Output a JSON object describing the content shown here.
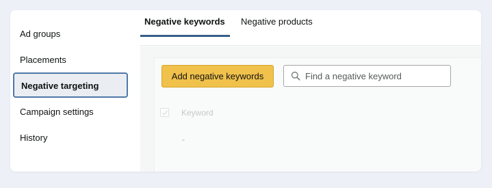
{
  "sidebar": {
    "items": [
      {
        "label": "Ad groups",
        "active": false
      },
      {
        "label": "Placements",
        "active": false
      },
      {
        "label": "Negative targeting",
        "active": true
      },
      {
        "label": "Campaign settings",
        "active": false
      },
      {
        "label": "History",
        "active": false
      }
    ]
  },
  "tabs": [
    {
      "label": "Negative keywords",
      "active": true
    },
    {
      "label": "Negative products",
      "active": false
    }
  ],
  "toolbar": {
    "add_label": "Add negative keywords",
    "search_placeholder": "Find a negative keyword",
    "search_value": ""
  },
  "table": {
    "columns": [
      "Keyword"
    ],
    "empty_value": "-"
  },
  "colors": {
    "accent": "#355d89",
    "button": "#f0c14b",
    "active_border": "#4f79a8",
    "background": "#eef0f8"
  },
  "icons": {
    "search": "search-icon",
    "checkbox": "checkbox-checked-icon"
  }
}
